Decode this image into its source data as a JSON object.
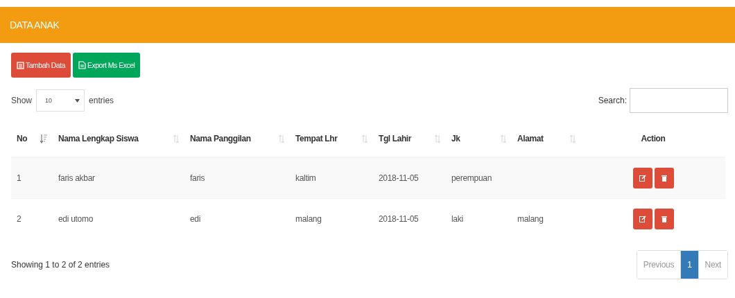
{
  "panel": {
    "title": "DATA ANAK"
  },
  "toolbar": [
    {
      "label": "Tambah Data",
      "kind": "add"
    },
    {
      "label": "Export Ms Excel",
      "kind": "export"
    }
  ],
  "length": {
    "prefix": "Show",
    "value": "10",
    "suffix": "entries"
  },
  "search": {
    "label": "Search:"
  },
  "table": {
    "columns": [
      {
        "label": "No",
        "kind": "sorted"
      },
      {
        "label": "Nama Lengkap Siswa",
        "kind": "sortable"
      },
      {
        "label": "Nama Panggilan",
        "kind": "sortable"
      },
      {
        "label": "Tempat Lhr",
        "kind": "sortable"
      },
      {
        "label": "Tgl Lahir",
        "kind": "sortable"
      },
      {
        "label": "Jk",
        "kind": "sortable"
      },
      {
        "label": "Alamat",
        "kind": "sortable"
      },
      {
        "label": "Action",
        "kind": "plain"
      }
    ],
    "rows": [
      {
        "cells": [
          "1",
          "faris akbar",
          "faris",
          "kaltim",
          "2018-11-05",
          "perempuan",
          ""
        ]
      },
      {
        "cells": [
          "2",
          "edi utomo",
          "edi",
          "malang",
          "2018-11-05",
          "laki",
          "malang"
        ]
      }
    ]
  },
  "info": "Showing 1 to 2 of 2 entries",
  "pagination": [
    {
      "label": "Previous",
      "selected": false,
      "disabled": true
    },
    {
      "label": "1",
      "selected": true,
      "disabled": false
    },
    {
      "label": "Next",
      "selected": false,
      "disabled": true
    }
  ]
}
